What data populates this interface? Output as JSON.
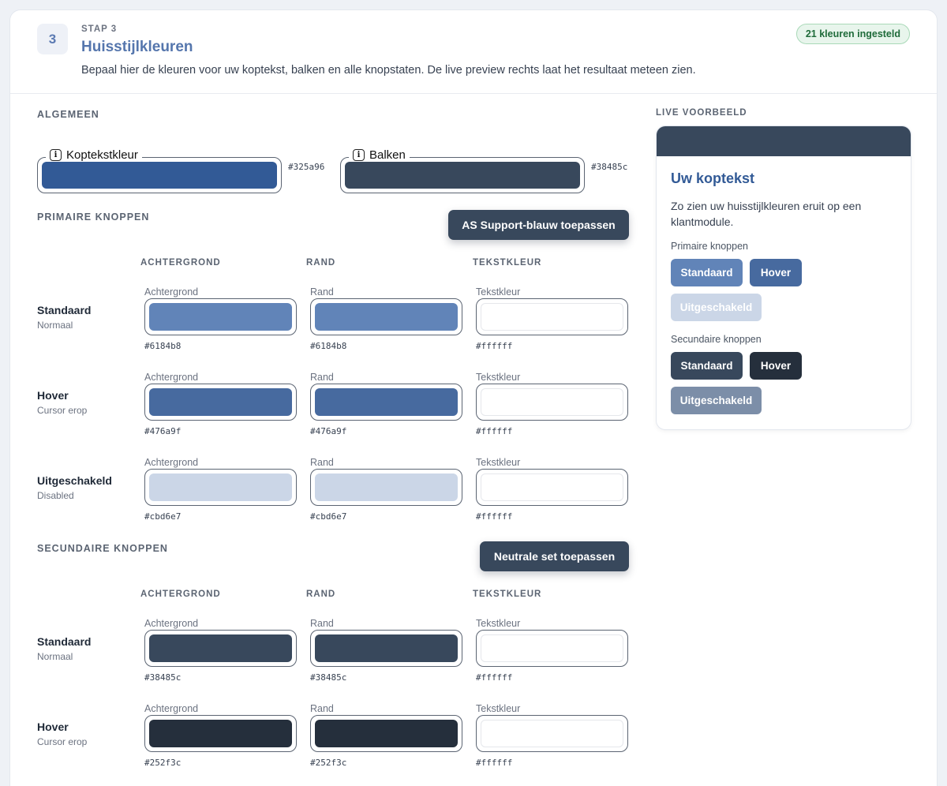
{
  "header": {
    "step_number": "3",
    "step_label": "STAP 3",
    "title": "Huisstijlkleuren",
    "description": "Bepaal hier de kleuren voor uw koptekst, balken en alle knopstaten. De live preview rechts laat het resultaat meteen zien.",
    "badge": "21 kleuren ingesteld"
  },
  "general": {
    "title": "ALGEMEEN",
    "heading_color": {
      "label": "Koptekstkleur",
      "value": "#325a96"
    },
    "bars": {
      "label": "Balken",
      "value": "#38485c"
    }
  },
  "columns": {
    "background": "ACHTERGROND",
    "border": "RAND",
    "text": "TEKSTKLEUR"
  },
  "field_labels": {
    "background": "Achtergrond",
    "border": "Rand",
    "text": "Tekstkleur"
  },
  "primary": {
    "title": "PRIMAIRE KNOPPEN",
    "apply_button": "AS Support-blauw toepassen",
    "rows": [
      {
        "name": "Standaard",
        "sub": "Normaal",
        "background": "#6184b8",
        "border": "#6184b8",
        "text": "#ffffff"
      },
      {
        "name": "Hover",
        "sub": "Cursor erop",
        "background": "#476a9f",
        "border": "#476a9f",
        "text": "#ffffff"
      },
      {
        "name": "Uitgeschakeld",
        "sub": "Disabled",
        "background": "#cbd6e7",
        "border": "#cbd6e7",
        "text": "#ffffff"
      }
    ]
  },
  "secondary": {
    "title": "SECUNDAIRE KNOPPEN",
    "apply_button": "Neutrale set toepassen",
    "rows": [
      {
        "name": "Standaard",
        "sub": "Normaal",
        "background": "#38485c",
        "border": "#38485c",
        "text": "#ffffff"
      },
      {
        "name": "Hover",
        "sub": "Cursor erop",
        "background": "#252f3c",
        "border": "#252f3c",
        "text": "#ffffff"
      }
    ]
  },
  "preview": {
    "section_title": "LIVE VOORBEELD",
    "heading": "Uw koptekst",
    "text": "Zo zien uw huisstijlkleuren eruit op een klantmodule.",
    "primary_label": "Primaire knoppen",
    "secondary_label": "Secundaire knoppen",
    "btn_standard": "Standaard",
    "btn_hover": "Hover",
    "btn_disabled": "Uitgeschakeld",
    "secondary_disabled_bg": "#7c8ea8"
  }
}
